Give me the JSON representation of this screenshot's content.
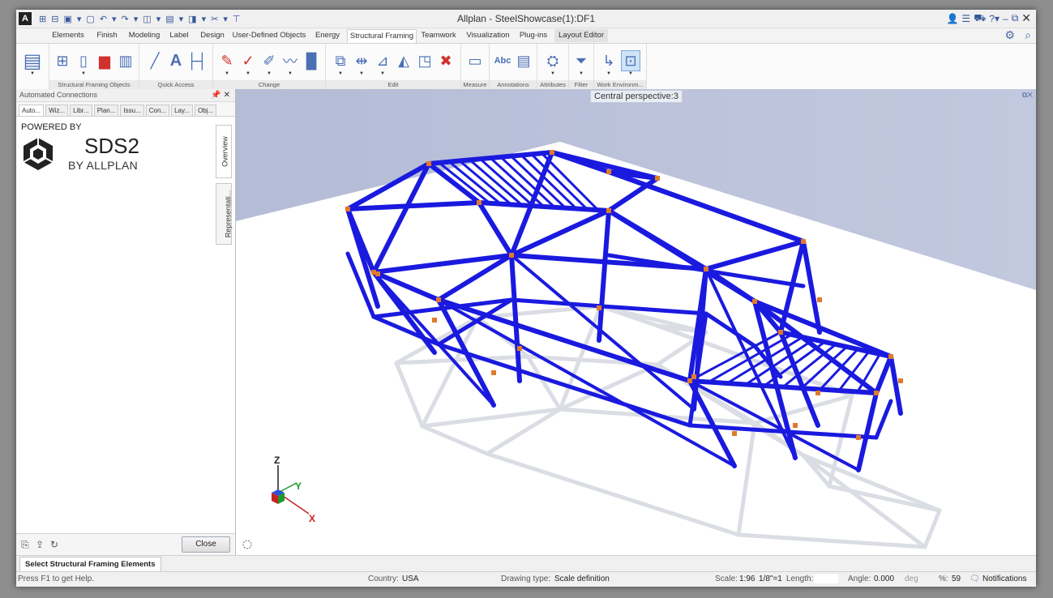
{
  "app": {
    "title": "Allplan - SteelShowcase(1):DF1",
    "logo": "A",
    "qat_icons": [
      "⊞",
      "⊟",
      "▣",
      "▾",
      "▢",
      "↶",
      "▾",
      "↷",
      "▾",
      "◫",
      "▾",
      "▤",
      "▾",
      "◨",
      "▾",
      "✂",
      "▾",
      "⊤"
    ]
  },
  "tabs": [
    {
      "label": "Elements"
    },
    {
      "label": "Finish"
    },
    {
      "label": "Modeling"
    },
    {
      "label": "Label"
    },
    {
      "label": "Design"
    },
    {
      "label": "User-Defined Objects"
    },
    {
      "label": "Energy"
    },
    {
      "label": "Structural Framing"
    },
    {
      "label": "Teamwork"
    },
    {
      "label": "Visualization"
    },
    {
      "label": "Plug-ins"
    },
    {
      "label": "Layout Editor"
    }
  ],
  "ribbon_groups": [
    {
      "label": "Structural Framing Objects"
    },
    {
      "label": "Quick Access"
    },
    {
      "label": "Change"
    },
    {
      "label": "Edit"
    },
    {
      "label": "Measure"
    },
    {
      "label": "Annotations"
    },
    {
      "label": "Attributes"
    },
    {
      "label": "Filter"
    },
    {
      "label": "Work Environm..."
    }
  ],
  "ribbon_text_icons": {
    "quick_access_A": "A",
    "annotations_abc": "Abc"
  },
  "panel": {
    "title": "Automated Connections",
    "tabs": [
      "Auto...",
      "Wiz...",
      "Libr...",
      "Plan...",
      "Issu...",
      "Con...",
      "Lay...",
      "Obj..."
    ],
    "powered_by": "POWERED BY",
    "brand_title": "SDS2",
    "brand_sub": "BY ALLPLAN",
    "vtab_overview": "Overview",
    "vtab_representation": "Representati...",
    "close_label": "Close"
  },
  "viewport": {
    "title": "Central perspective:3",
    "axis_z": "Z",
    "axis_y": "Y",
    "axis_x": "X",
    "colors": {
      "steel": "#1a1adf",
      "joint": "#e07a2a",
      "wall": "#b8bfd8",
      "floor": "#ffffff"
    }
  },
  "bottom_tab": "Select Structural Framing Elements",
  "status": {
    "help": "Press F1 to get Help.",
    "country_label": "Country:",
    "country": "USA",
    "drawing_type_label": "Drawing type:",
    "drawing_type": "Scale definition",
    "scale_label": "Scale:",
    "scale": "1:96",
    "scale2": "1/8\"=1",
    "length_label": "Length:",
    "angle_label": "Angle:",
    "angle": "0.000",
    "angle_unit": "deg",
    "percent_label": "%:",
    "percent": "59",
    "notifications": "Notifications"
  }
}
